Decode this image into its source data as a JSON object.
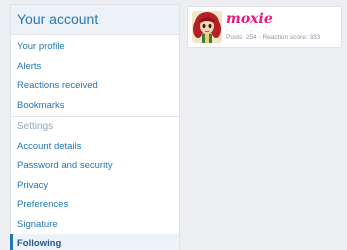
{
  "sidebar": {
    "title": "Your account",
    "items": [
      {
        "label": "Your profile"
      },
      {
        "label": "Alerts"
      },
      {
        "label": "Reactions received"
      },
      {
        "label": "Bookmarks"
      }
    ],
    "settings_label": "Settings",
    "settings_items": [
      {
        "label": "Account details"
      },
      {
        "label": "Password and security"
      },
      {
        "label": "Privacy"
      },
      {
        "label": "Preferences"
      },
      {
        "label": "Signature"
      },
      {
        "label": "Following"
      }
    ],
    "active_item": "Following"
  },
  "member": {
    "username": "moxie",
    "stats": "Posts: 254 · Reaction score: 333",
    "username_color": "#e8177c",
    "avatar_icon": "cartoon-girl-avatar"
  },
  "colors": {
    "accent": "#2577b1",
    "header_bg": "#ecf2f8",
    "page_bg": "#eceef1"
  }
}
